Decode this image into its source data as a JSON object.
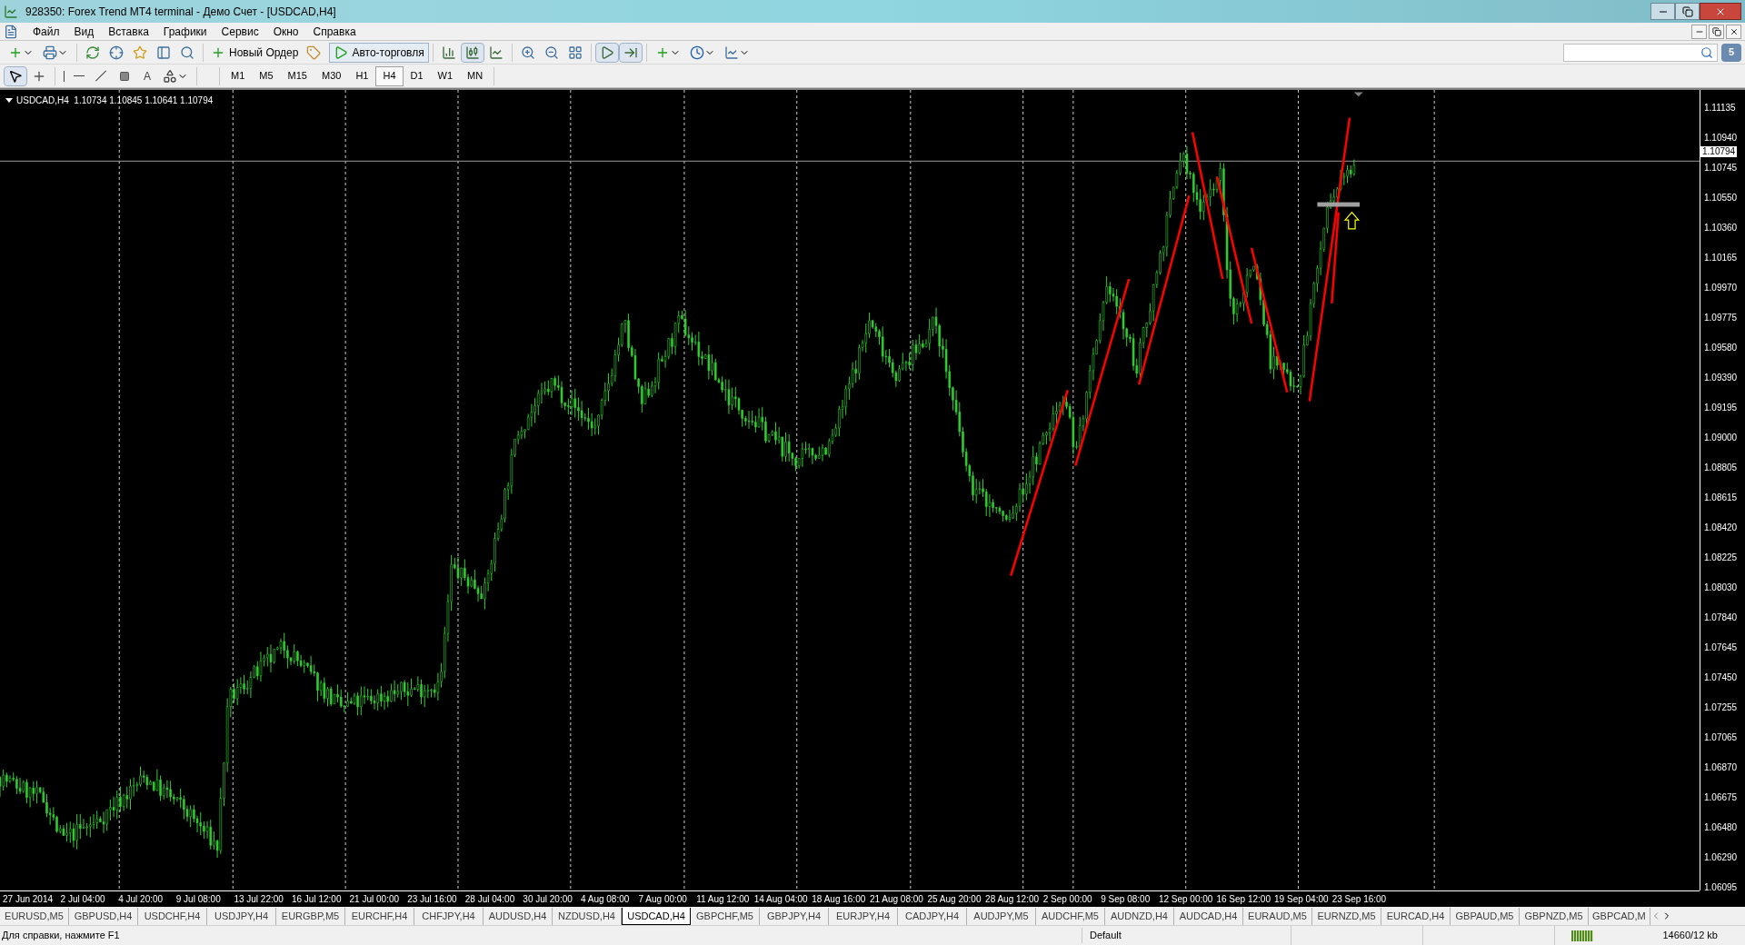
{
  "window": {
    "title": "928350: Forex Trend MT4 terminal - Демо Счет - [USDCAD,H4]"
  },
  "menu": [
    "Файл",
    "Вид",
    "Вставка",
    "Графики",
    "Сервис",
    "Окно",
    "Справка"
  ],
  "toolbar": {
    "new_order": "Новый Ордер",
    "auto_trading": {
      "label": "Авто-торговля",
      "selected": true
    },
    "notifications_badge": "5"
  },
  "drawing_tools": {
    "text_tool": "A"
  },
  "timeframes": [
    {
      "label": "M1",
      "selected": false
    },
    {
      "label": "M5",
      "selected": false
    },
    {
      "label": "M15",
      "selected": false
    },
    {
      "label": "M30",
      "selected": false
    },
    {
      "label": "H1",
      "selected": false
    },
    {
      "label": "H4",
      "selected": true
    },
    {
      "label": "D1",
      "selected": false
    },
    {
      "label": "W1",
      "selected": false
    },
    {
      "label": "MN",
      "selected": false
    }
  ],
  "chart": {
    "header": "USDCAD,H4  1.10734 1.10845 1.10641 1.10794",
    "current_price": "1.10794",
    "price_labels": [
      "1.11135",
      "1.10940",
      "1.10745",
      "1.10550",
      "1.10360",
      "1.10165",
      "1.09970",
      "1.09775",
      "1.09580",
      "1.09390",
      "1.09195",
      "1.09000",
      "1.08805",
      "1.08615",
      "1.08420",
      "1.08225",
      "1.08030",
      "1.07840",
      "1.07645",
      "1.07450",
      "1.07255",
      "1.07065",
      "1.06870",
      "1.06675",
      "1.06480",
      "1.06290",
      "1.06095"
    ],
    "time_labels": [
      "27 Jun 2014",
      "2 Jul 04:00",
      "4 Jul 20:00",
      "9 Jul 08:00",
      "13 Jul 22:00",
      "16 Jul 12:00",
      "21 Jul 00:00",
      "23 Jul 16:00",
      "28 Jul 04:00",
      "30 Jul 20:00",
      "4 Aug 08:00",
      "7 Aug 00:00",
      "11 Aug 12:00",
      "14 Aug 04:00",
      "18 Aug 16:00",
      "21 Aug 08:00",
      "25 Aug 20:00",
      "28 Aug 12:00",
      "2 Sep 00:00",
      "9 Sep 08:00",
      "12 Sep 00:00",
      "16 Sep 12:00",
      "19 Sep 04:00",
      "23 Sep 16:00"
    ]
  },
  "symbol_tabs": [
    {
      "label": "EURUSD,M5",
      "selected": false
    },
    {
      "label": "GBPUSD,H4",
      "selected": false
    },
    {
      "label": "USDCHF,H4",
      "selected": false
    },
    {
      "label": "USDJPY,H4",
      "selected": false
    },
    {
      "label": "EURGBP,M5",
      "selected": false
    },
    {
      "label": "EURCHF,H4",
      "selected": false
    },
    {
      "label": "CHFJPY,H4",
      "selected": false
    },
    {
      "label": "AUDUSD,H4",
      "selected": false
    },
    {
      "label": "NZDUSD,H4",
      "selected": false
    },
    {
      "label": "USDCAD,H4",
      "selected": true
    },
    {
      "label": "GBPCHF,M5",
      "selected": false
    },
    {
      "label": "GBPJPY,H4",
      "selected": false
    },
    {
      "label": "EURJPY,H4",
      "selected": false
    },
    {
      "label": "CADJPY,H4",
      "selected": false
    },
    {
      "label": "AUDJPY,M5",
      "selected": false
    },
    {
      "label": "AUDCHF,M5",
      "selected": false
    },
    {
      "label": "AUDNZD,H4",
      "selected": false
    },
    {
      "label": "AUDCAD,H4",
      "selected": false
    },
    {
      "label": "EURAUD,M5",
      "selected": false
    },
    {
      "label": "EURNZD,M5",
      "selected": false
    },
    {
      "label": "EURCAD,H4",
      "selected": false
    },
    {
      "label": "GBPAUD,M5",
      "selected": false
    },
    {
      "label": "GBPNZD,M5",
      "selected": false
    },
    {
      "label": "GBPCAD,M",
      "selected": false
    }
  ],
  "status_bar": {
    "help": "Для справки, нажмите F1",
    "profile": "Default",
    "traffic": "14660/12 kb"
  }
}
